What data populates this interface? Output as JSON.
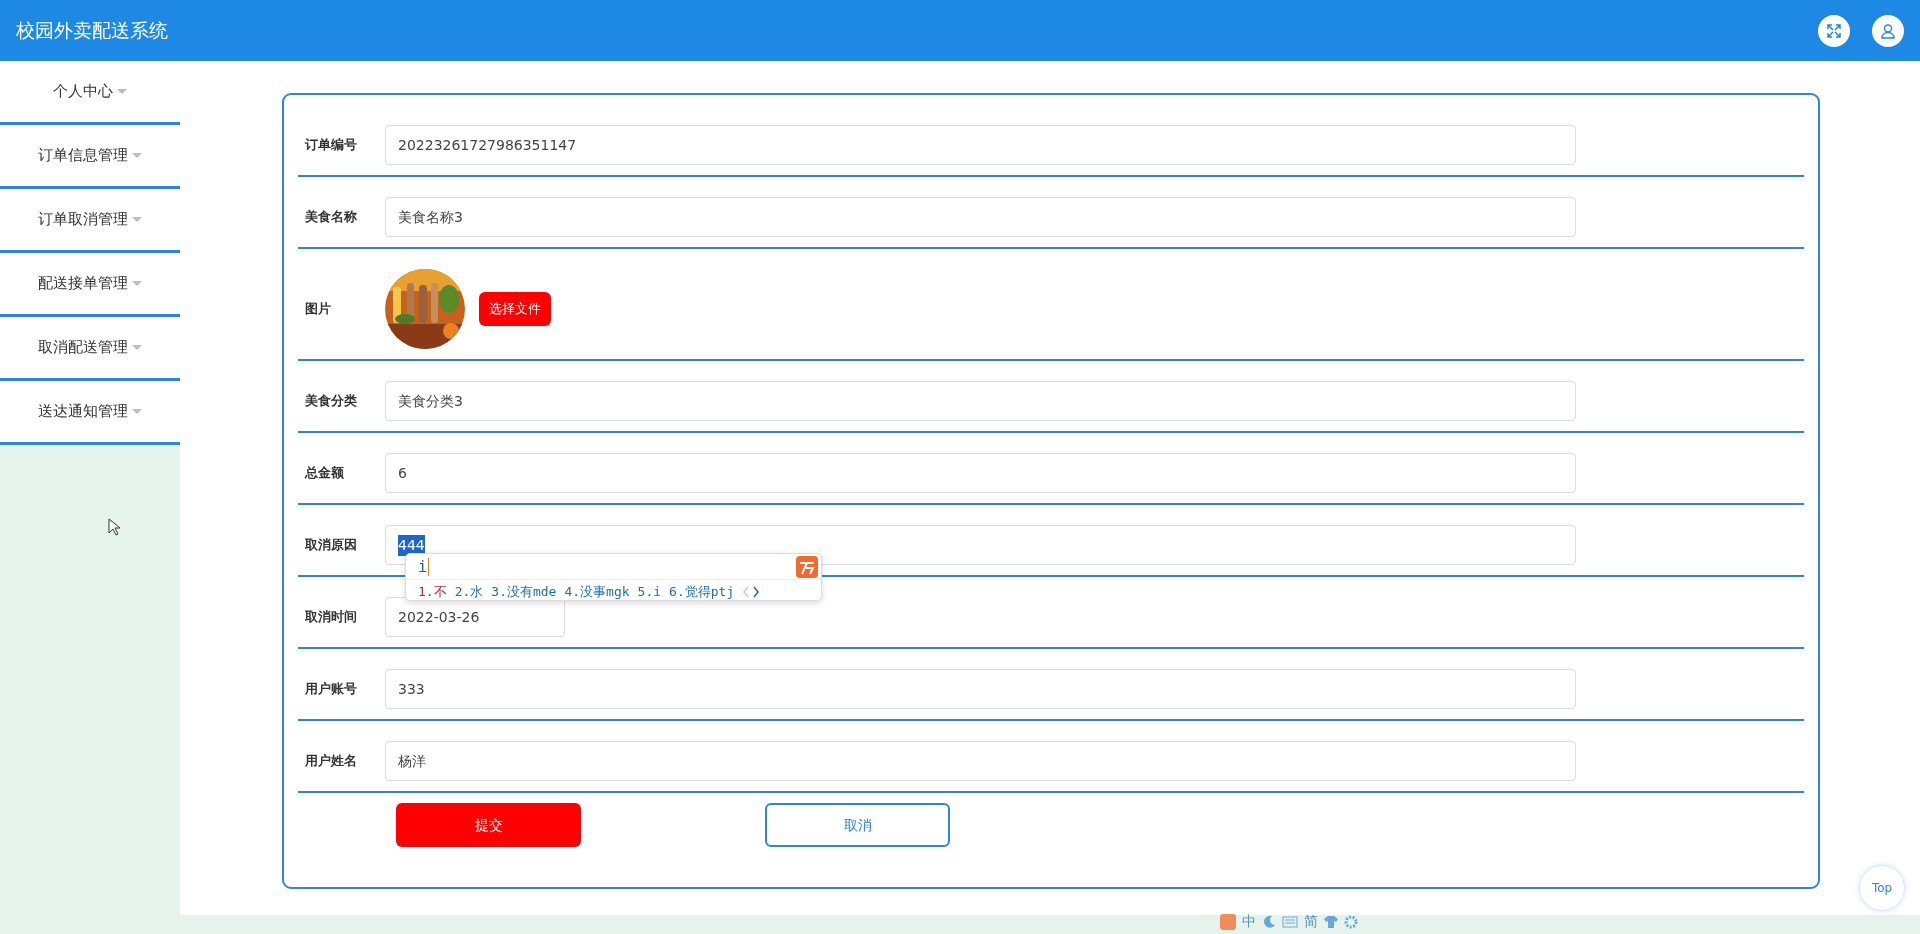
{
  "header": {
    "title": "校园外卖配送系统"
  },
  "sidebar": {
    "items": [
      {
        "label": "个人中心"
      },
      {
        "label": "订单信息管理"
      },
      {
        "label": "订单取消管理"
      },
      {
        "label": "配送接单管理"
      },
      {
        "label": "取消配送管理"
      },
      {
        "label": "送达通知管理"
      }
    ]
  },
  "form": {
    "fields": [
      {
        "kind": "text",
        "label": "订单编号",
        "value": "20223261727986351147"
      },
      {
        "kind": "text",
        "label": "美食名称",
        "value": "美食名称3"
      },
      {
        "label": "图片",
        "button": "选择文件"
      },
      {
        "kind": "text",
        "label": "美食分类",
        "value": "美食分类3"
      },
      {
        "kind": "text",
        "label": "总金额",
        "value": "6"
      },
      {
        "kind": "text",
        "label": "取消原因",
        "value": "444",
        "highlighted": true
      },
      {
        "kind": "date",
        "label": "取消时间",
        "value": "2022-03-26"
      },
      {
        "kind": "text",
        "label": "用户账号",
        "value": "333"
      },
      {
        "kind": "text",
        "label": "用户姓名",
        "value": "杨洋"
      }
    ],
    "buttons": [
      {
        "kind": "primary",
        "label": "提交"
      },
      {
        "kind": "outline",
        "label": "取消"
      }
    ]
  },
  "ime_popup": {
    "input": "i",
    "candidates": [
      {
        "label": "1.不",
        "selected": true
      },
      {
        "label": "2.水",
        "selected": false
      },
      {
        "label": "3.没有mde",
        "selected": false
      },
      {
        "label": "4.没事mgk",
        "selected": false
      },
      {
        "label": "5.i",
        "selected": false
      },
      {
        "label": "6.觉得ptj",
        "selected": false
      }
    ]
  },
  "ime_toolbar": {
    "mode": "中",
    "script": "简"
  },
  "top_button": {
    "label": "Top"
  }
}
